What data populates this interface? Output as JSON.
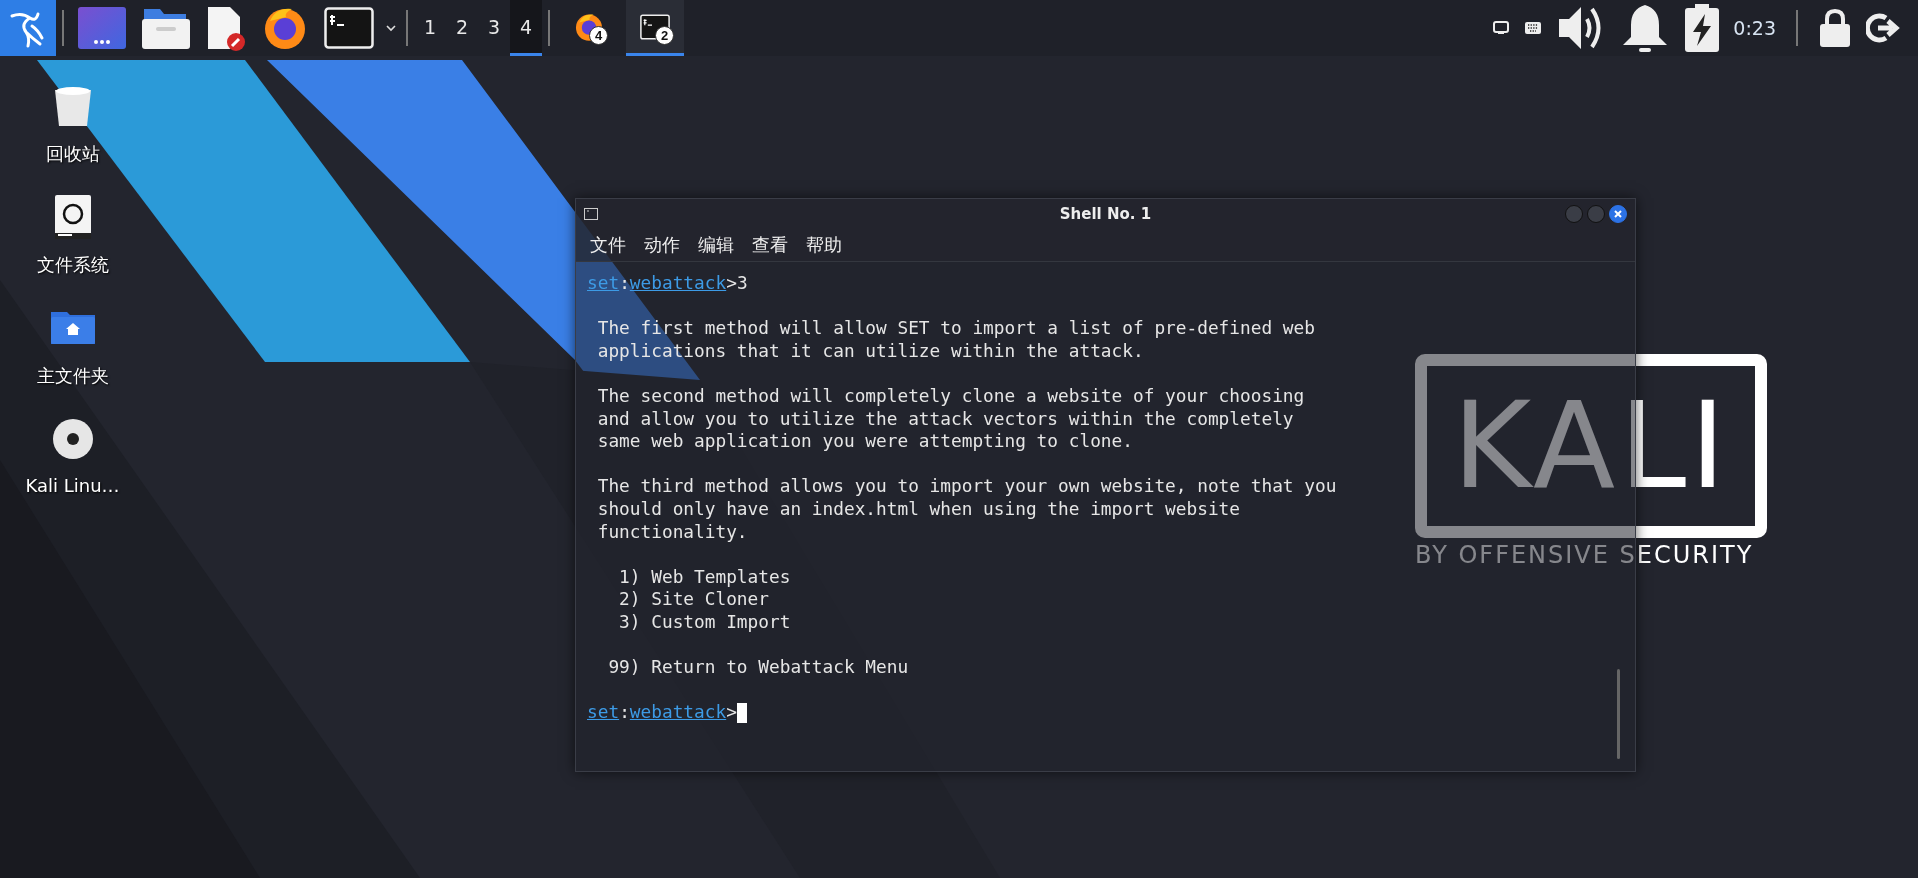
{
  "taskbar": {
    "launchers": [
      {
        "kind": "menu",
        "selected": true
      },
      {
        "kind": "workspaces",
        "selected": false
      },
      {
        "kind": "files",
        "selected": false
      },
      {
        "kind": "editor",
        "selected": false
      },
      {
        "kind": "browser",
        "selected": false
      },
      {
        "kind": "terminal",
        "selected": false
      }
    ],
    "workspaces": [
      {
        "label": "1",
        "selected": false
      },
      {
        "label": "2",
        "selected": false
      },
      {
        "label": "3",
        "selected": false
      },
      {
        "label": "4",
        "selected": true
      }
    ],
    "windows": [
      {
        "kind": "browser",
        "badge": "4",
        "selected": false
      },
      {
        "kind": "terminal",
        "badge": "2",
        "selected": true
      }
    ],
    "tray": {
      "clock": "0:23"
    }
  },
  "wallpaper": {
    "logo": "KALI",
    "tagline": "BY OFFENSIVE SECURITY"
  },
  "desktop_icons": [
    {
      "kind": "trash",
      "label": "回收站"
    },
    {
      "kind": "drive",
      "label": "文件系统"
    },
    {
      "kind": "home",
      "label": "主文件夹"
    },
    {
      "kind": "disc",
      "label": "Kali Linu…"
    }
  ],
  "terminal": {
    "title": "Shell No. 1",
    "menu": [
      "文件",
      "动作",
      "编辑",
      "查看",
      "帮助"
    ],
    "lines": [
      {
        "kind": "prompt",
        "parts": [
          {
            "text": "set",
            "link": true
          },
          {
            "text": ":",
            "link": false
          },
          {
            "text": "webattack",
            "link": true
          },
          {
            "text": ">3",
            "link": false
          }
        ]
      },
      {
        "kind": "blank"
      },
      {
        "kind": "text",
        "text": " The first method will allow SET to import a list of pre-defined web"
      },
      {
        "kind": "text",
        "text": " applications that it can utilize within the attack."
      },
      {
        "kind": "blank"
      },
      {
        "kind": "text",
        "text": " The second method will completely clone a website of your choosing"
      },
      {
        "kind": "text",
        "text": " and allow you to utilize the attack vectors within the completely"
      },
      {
        "kind": "text",
        "text": " same web application you were attempting to clone."
      },
      {
        "kind": "blank"
      },
      {
        "kind": "text",
        "text": " The third method allows you to import your own website, note that you"
      },
      {
        "kind": "text",
        "text": " should only have an index.html when using the import website"
      },
      {
        "kind": "text",
        "text": " functionality."
      },
      {
        "kind": "blank"
      },
      {
        "kind": "text",
        "text": "   1) Web Templates"
      },
      {
        "kind": "text",
        "text": "   2) Site Cloner"
      },
      {
        "kind": "text",
        "text": "   3) Custom Import"
      },
      {
        "kind": "blank"
      },
      {
        "kind": "text",
        "text": "  99) Return to Webattack Menu"
      },
      {
        "kind": "blank"
      },
      {
        "kind": "prompt",
        "parts": [
          {
            "text": "set",
            "link": true
          },
          {
            "text": ":",
            "link": false
          },
          {
            "text": "webattack",
            "link": true
          },
          {
            "text": ">",
            "link": false
          }
        ],
        "cursor": true
      }
    ]
  }
}
